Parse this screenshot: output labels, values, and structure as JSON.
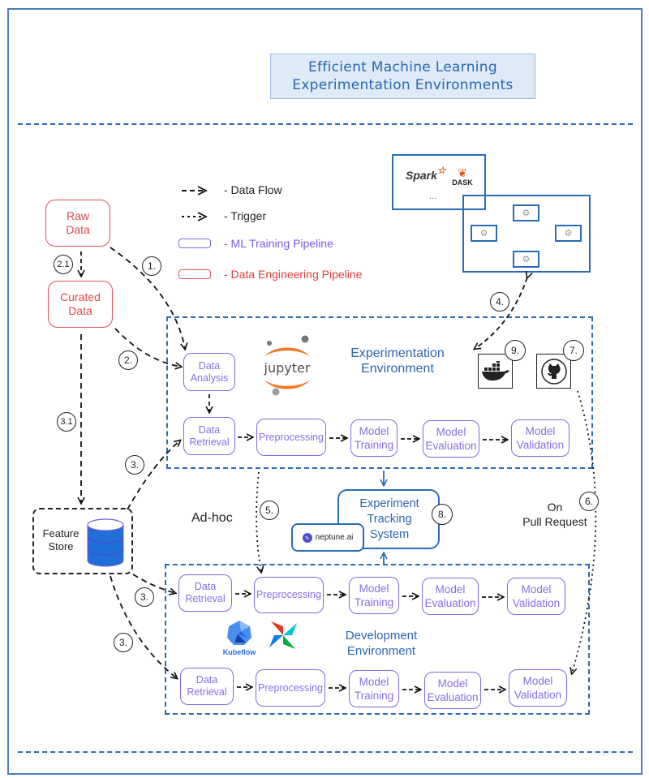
{
  "title": {
    "line1": "Efficient Machine Learning",
    "line2": "Experimentation Environments"
  },
  "legend": {
    "data_flow": "- Data Flow",
    "trigger": "- Trigger",
    "ml_pipeline": "- ML Training Pipeline",
    "de_pipeline": "- Data Engineering Pipeline"
  },
  "colors": {
    "ml_pipeline": "#8866e8",
    "de_pipeline": "#e45555",
    "environment": "#2a6cb8"
  },
  "data_sources": {
    "raw": "Raw Data",
    "curated": "Curated Data",
    "feature_store": "Feature Store"
  },
  "compute_cluster": {
    "logos": [
      "Spark",
      "DASK"
    ],
    "more": "...",
    "spark_icon": "spark-logo-icon",
    "dask_icon": "dask-logo-icon",
    "worker_icon": "gears-icon",
    "workers": 4
  },
  "experimentation": {
    "label_line1": "Experimentation",
    "label_line2": "Environment",
    "logo": "jupyter",
    "data_analysis": "Data Analysis",
    "pipeline": [
      "Data Retrieval",
      "Preprocessing",
      "Model Training",
      "Model Evaluation",
      "Model Validation"
    ],
    "tools": [
      {
        "icon": "docker-icon",
        "badge": "9."
      },
      {
        "icon": "github-icon",
        "badge": "7."
      }
    ]
  },
  "tracking": {
    "label_line1": "Experiment",
    "label_line2": "Tracking",
    "label_line3": "System",
    "vendor": "neptune.ai",
    "badge": "8."
  },
  "development": {
    "label_line1": "Development",
    "label_line2": "Environment",
    "logos": [
      "Kubeflow",
      "airflow-pinwheel"
    ],
    "kubeflow_text": "Kubeflow",
    "pipeline_adhoc": [
      "Data Retrieval",
      "Preprocessing",
      "Model Training",
      "Model Evaluation",
      "Model Validation"
    ],
    "pipeline_pr": [
      "Data Retrieval",
      "Preprocessing",
      "Model Training",
      "Model Evaluation",
      "Model Validation"
    ]
  },
  "annotations": {
    "adhoc": "Ad-hoc",
    "on": "On",
    "pull_request": "Pull Request"
  },
  "badges": {
    "b1": "1.",
    "b2": "2.",
    "b21": "2.1",
    "b3a": "3.",
    "b3b": "3.",
    "b3c": "3.",
    "b31": "3.1",
    "b4": "4.",
    "b5": "5.",
    "b6": "6."
  }
}
